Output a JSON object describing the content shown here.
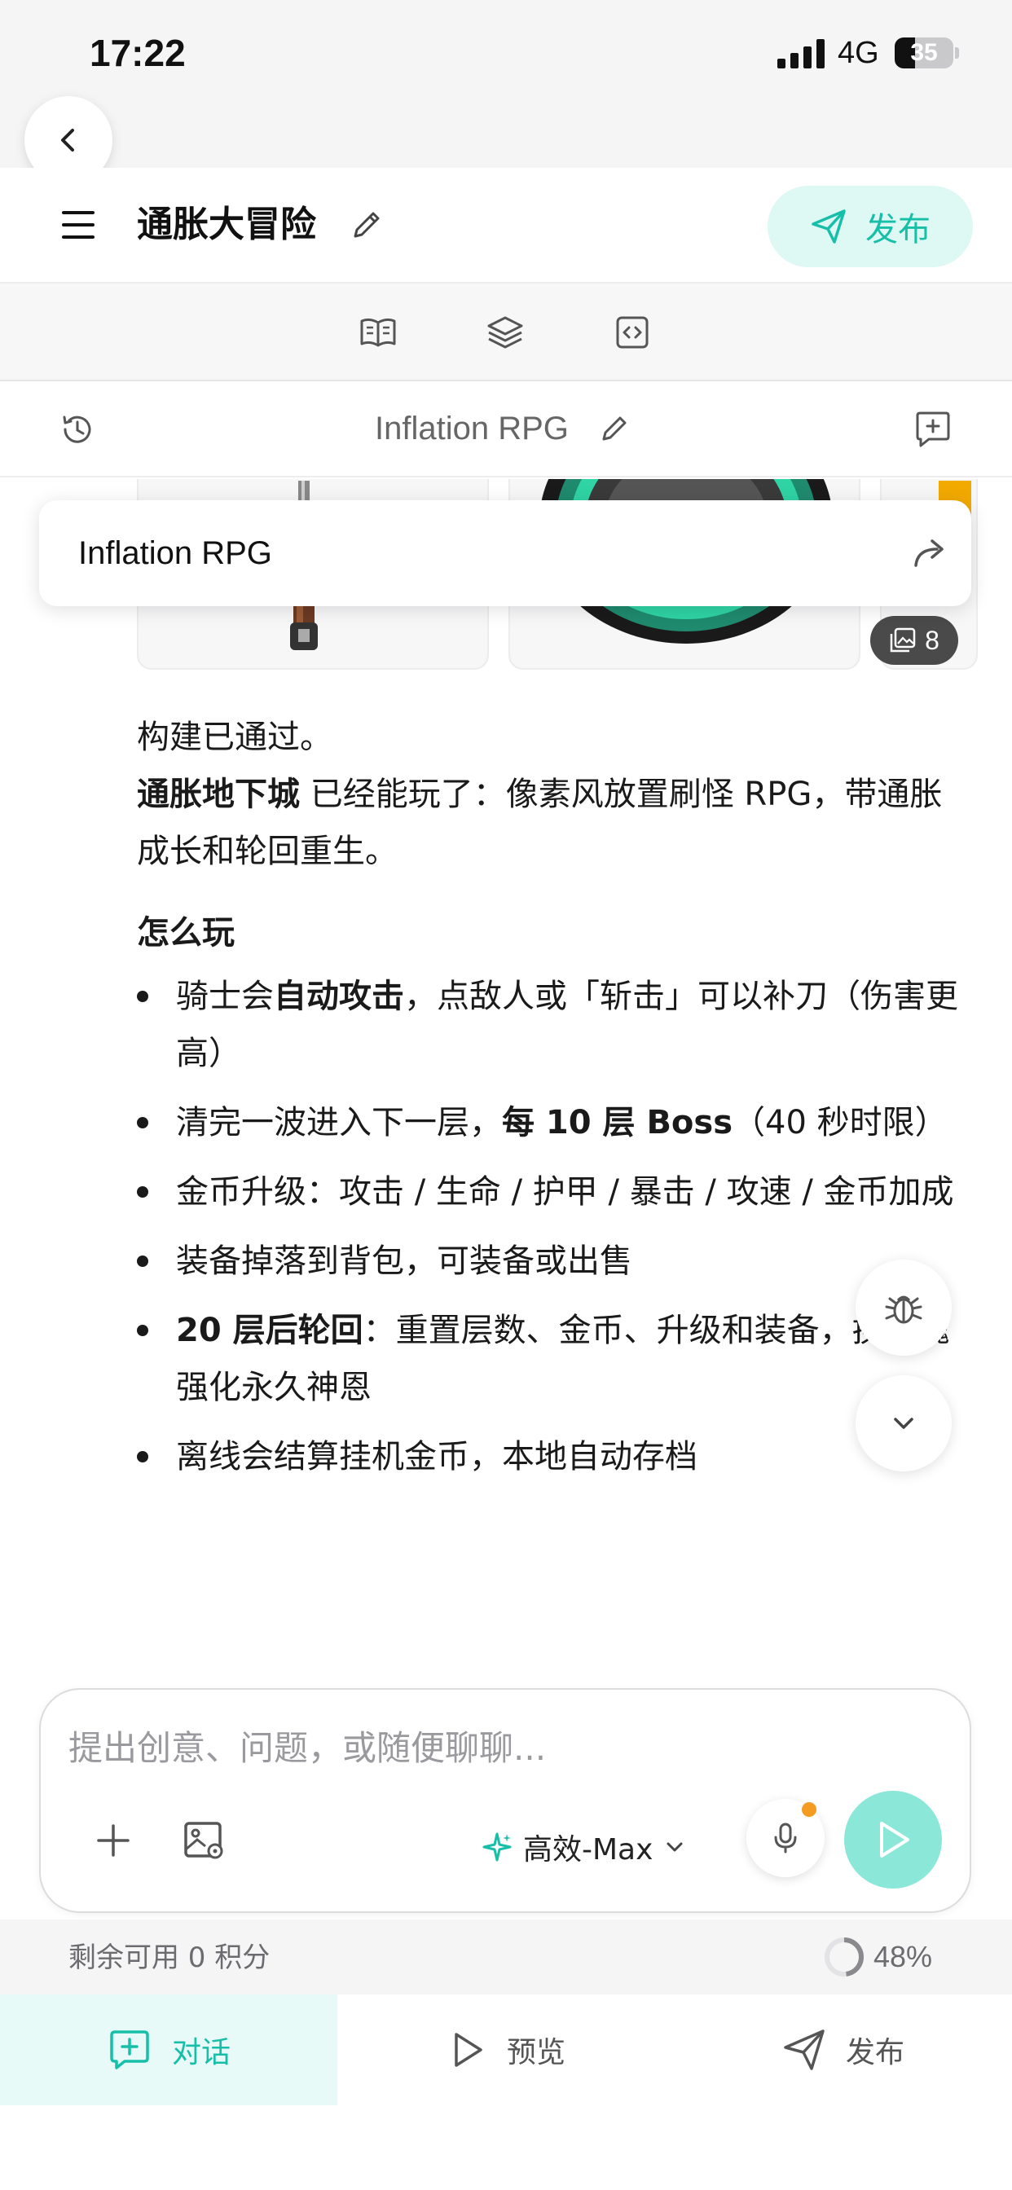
{
  "status_bar": {
    "time": "17:22",
    "network": "4G",
    "battery": "35",
    "battery_level": 0.35
  },
  "header": {
    "title": "通胀大冒险",
    "publish_label": "发布"
  },
  "session": {
    "title": "Inflation RPG"
  },
  "link_card": {
    "title": "Inflation RPG"
  },
  "gallery": {
    "image_count": "8"
  },
  "message": {
    "line1": "构建已通过。",
    "intro_bold": "通胀地下城",
    "intro_rest": " 已经能玩了：像素风放置刷怪 RPG，带通胀成长和轮回重生。",
    "heading": "怎么玩",
    "bullets": [
      {
        "prefix": "骑士会",
        "bold": "自动攻击",
        "suffix": "，点敌人或「斩击」可以补刀（伤害更高）"
      },
      {
        "prefix": "清完一波进入下一层，",
        "bold": "每 10 层 Boss",
        "suffix": "（40 秒时限）"
      },
      {
        "prefix": "金币升级：攻击 / 生命 / 护甲 / 暴击 / 攻速 / 金币加成",
        "bold": "",
        "suffix": ""
      },
      {
        "prefix": "装备掉落到背包，可装备或出售",
        "bold": "",
        "suffix": ""
      },
      {
        "prefix": "",
        "bold": "20 层后轮回",
        "suffix": "：重置层数、金币、升级和装备，换灵魂强化永久神恩"
      },
      {
        "prefix": "离线会结算挂机金币，本地自动存档",
        "bold": "",
        "suffix": ""
      }
    ]
  },
  "composer": {
    "placeholder": "提出创意、问题，或随便聊聊...",
    "model": "高效-Max"
  },
  "credits": {
    "text": "剩余可用 0 积分",
    "usage_percent": "48%",
    "usage_value": 0.48
  },
  "tabs": [
    {
      "label": "对话",
      "icon": "chat-icon",
      "active": true
    },
    {
      "label": "预览",
      "icon": "play-icon",
      "active": false
    },
    {
      "label": "发布",
      "icon": "send-icon",
      "active": false
    }
  ],
  "colors": {
    "accent": "#17bfa9",
    "accent_light": "#def8f4",
    "send_button": "#8be7d8",
    "mic_dot": "#f49b22"
  }
}
